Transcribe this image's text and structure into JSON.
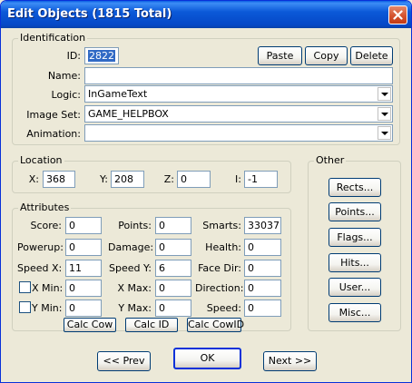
{
  "window": {
    "title": "Edit Objects (1815 Total)"
  },
  "identification": {
    "group_label": "Identification",
    "id_label": "ID:",
    "id_value": "2822",
    "paste_label": "Paste",
    "copy_label": "Copy",
    "delete_label": "Delete",
    "name_label": "Name:",
    "name_value": "",
    "logic_label": "Logic:",
    "logic_value": "InGameText",
    "imageset_label": "Image Set:",
    "imageset_value": "GAME_HELPBOX",
    "animation_label": "Animation:",
    "animation_value": ""
  },
  "location": {
    "group_label": "Location",
    "x_label": "X:",
    "x_value": "368",
    "y_label": "Y:",
    "y_value": "208",
    "z_label": "Z:",
    "z_value": "0",
    "i_label": "I:",
    "i_value": "-1"
  },
  "attributes": {
    "group_label": "Attributes",
    "score_label": "Score:",
    "score_value": "0",
    "points_label": "Points:",
    "points_value": "0",
    "smarts_label": "Smarts:",
    "smarts_value": "33037",
    "powerup_label": "Powerup:",
    "powerup_value": "0",
    "damage_label": "Damage:",
    "damage_value": "0",
    "health_label": "Health:",
    "health_value": "0",
    "speedx_label": "Speed X:",
    "speedx_value": "11",
    "speedy_label": "Speed Y:",
    "speedy_value": "6",
    "facedir_label": "Face Dir:",
    "facedir_value": "0",
    "xmin_label": "X Min:",
    "xmin_value": "0",
    "xmax_label": "X Max:",
    "xmax_value": "0",
    "direction_label": "Direction:",
    "direction_value": "0",
    "ymin_label": "Y Min:",
    "ymin_value": "0",
    "ymax_label": "Y Max:",
    "ymax_value": "0",
    "speed_label": "Speed:",
    "speed_value": "0",
    "calc_cow_label": "Calc Cow",
    "calc_id_label": "Calc ID",
    "calc_cowid_label": "Calc CowID"
  },
  "other": {
    "group_label": "Other",
    "rects_label": "Rects...",
    "points_label": "Points...",
    "flags_label": "Flags...",
    "hits_label": "Hits...",
    "user_label": "User...",
    "misc_label": "Misc..."
  },
  "footer": {
    "prev_label": "<< Prev",
    "ok_label": "OK",
    "next_label": "Next >>"
  }
}
